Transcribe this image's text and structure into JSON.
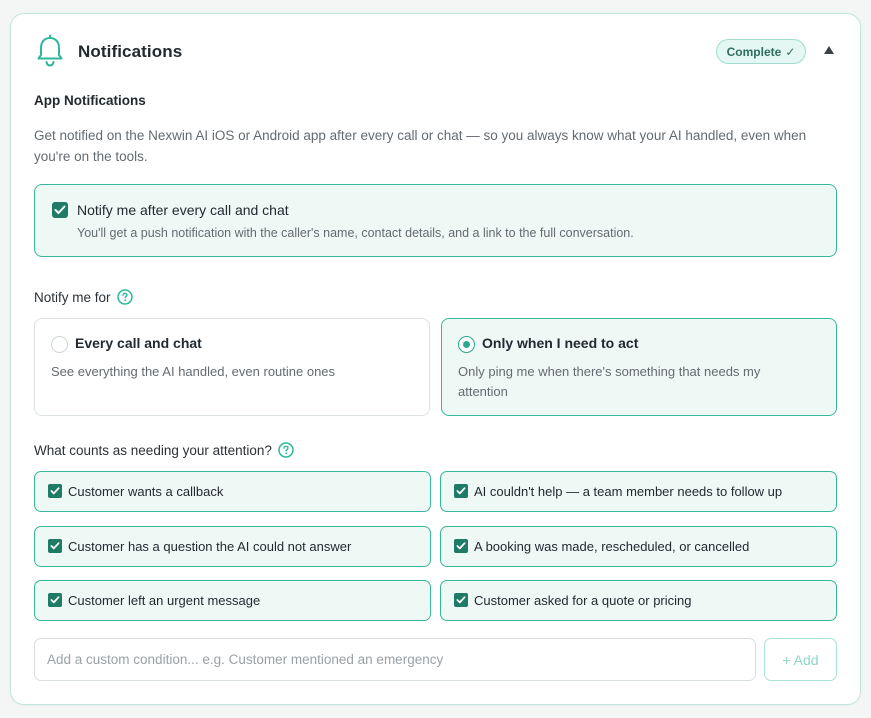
{
  "header": {
    "title": "Notifications",
    "status_badge": "Complete",
    "status_check": "✓",
    "collapse_glyph": "▲",
    "icon": "bell-icon"
  },
  "app_notifications": {
    "heading": "App Notifications",
    "description": "Get notified on the Nexwin AI iOS or Android app after every call or chat — so you always know what your AI handled, even when you're on the tools.",
    "toggle": {
      "checked": true,
      "label": "Notify me after every call and chat",
      "sublabel": "You'll get a push notification with the caller's name, contact details, and a link to the full conversation."
    }
  },
  "notify_for": {
    "label": "Notify me for",
    "options": [
      {
        "title": "Every call and chat",
        "description": "See everything the AI handled, even routine ones",
        "selected": false
      },
      {
        "title": "Only when I need to act",
        "description": "Only ping me when there's something that needs my attention",
        "selected": true
      }
    ]
  },
  "attention": {
    "label": "What counts as needing your attention?",
    "conditions": [
      {
        "label": "Customer wants a callback",
        "checked": true
      },
      {
        "label": "AI couldn't help — a team member needs to follow up",
        "checked": true
      },
      {
        "label": "Customer has a question the AI could not answer",
        "checked": true
      },
      {
        "label": "A booking was made, rescheduled, or cancelled",
        "checked": true
      },
      {
        "label": "Customer left an urgent message",
        "checked": true
      },
      {
        "label": "Customer asked for a quote or pricing",
        "checked": true
      }
    ],
    "custom": {
      "placeholder": "Add a custom condition... e.g. Customer mentioned an emergency",
      "value": "",
      "add_label": "+ Add"
    }
  },
  "colors": {
    "accent": "#2aa88e",
    "checkbox": "#1f7a66",
    "selected_bg": "#eef9f6",
    "border_accent": "#39b79c"
  }
}
